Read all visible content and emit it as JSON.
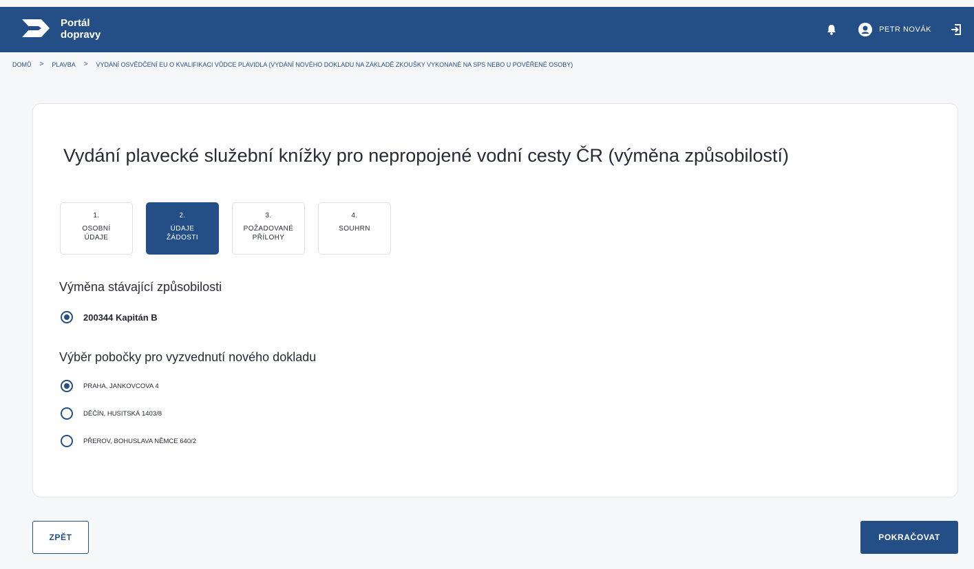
{
  "header": {
    "logo_line1": "Portál",
    "logo_line2": "dopravy",
    "user_name": "PETR NOVÁK",
    "icons": [
      "logo-arrow-icon",
      "bell-icon",
      "user-avatar-icon",
      "logout-icon"
    ],
    "brand_color": "#244f86"
  },
  "breadcrumb": {
    "items": [
      "DOMŮ",
      "PLAVBA",
      "VYDÁNÍ OSVĚDČENÍ EU O KVALIFIKACI VŮDCE PLAVIDLA (VYDÁNÍ NOVÉHO DOKLADU NA ZÁKLADĚ ZKOUŠKY VYKONANÉ NA SPS NEBO U POVĚŘENÉ OSOBY)"
    ],
    "separator": ">"
  },
  "main": {
    "title": "Vydání plavecké služební knížky pro nepropojené vodní cesty ČR (výměna způsobilostí)",
    "steps": [
      {
        "number": "1.",
        "label": "OSOBNÍ\nÚDAJE",
        "active": false
      },
      {
        "number": "2.",
        "label": "ÚDAJE\nŽÁDOSTI",
        "active": true
      },
      {
        "number": "3.",
        "label": "POŽADOVANÉ\nPŘÍLOHY",
        "active": false
      },
      {
        "number": "4.",
        "label": "SOUHRN",
        "active": false
      }
    ],
    "section1_title": "Výměna stávající způsobilosti",
    "qualification": {
      "label": "200344 Kapitán B",
      "selected": true
    },
    "section2_title": "Výběr pobočky pro vyzvednutí nového dokladu",
    "branches": [
      {
        "label": "PRAHA, JANKOVCOVA 4",
        "selected": true
      },
      {
        "label": "DĚČÍN, HUSITSKÁ 1403/8",
        "selected": false
      },
      {
        "label": "PŘEROV, BOHUSLAVA NĚMCE 640/2",
        "selected": false
      }
    ]
  },
  "footer": {
    "back_label": "ZPĚT",
    "next_label": "POKRAČOVAT"
  }
}
